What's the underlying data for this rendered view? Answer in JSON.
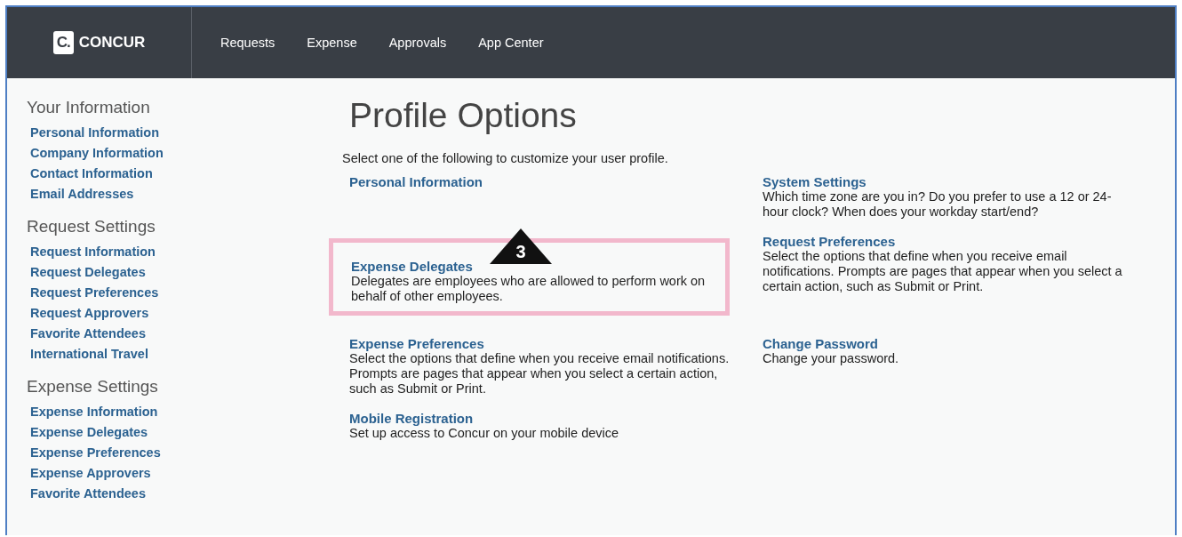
{
  "header": {
    "logo_mark": "C.",
    "logo_text": "CONCUR",
    "nav": [
      {
        "label": "Requests"
      },
      {
        "label": "Expense"
      },
      {
        "label": "Approvals"
      },
      {
        "label": "App Center"
      }
    ]
  },
  "sidebar": [
    {
      "heading": "Your Information",
      "items": [
        "Personal Information",
        "Company Information",
        "Contact Information",
        "Email Addresses"
      ]
    },
    {
      "heading": "Request Settings",
      "items": [
        "Request Information",
        "Request Delegates",
        "Request Preferences",
        "Request Approvers",
        "Favorite Attendees",
        "International Travel"
      ]
    },
    {
      "heading": "Expense Settings",
      "items": [
        "Expense Information",
        "Expense Delegates",
        "Expense Preferences",
        "Expense Approvers",
        "Favorite Attendees"
      ]
    }
  ],
  "title": "Profile Options",
  "intro": "Select one of the following to customize your user profile.",
  "option_rows": [
    {
      "cells": [
        {
          "link": "Personal Information",
          "highlighted": false
        },
        {
          "link": "System Settings",
          "description": "Which time zone are you in? Do you prefer to use a 12 or 24-hour clock? When does your workday start/end?",
          "highlighted": false
        }
      ]
    },
    {
      "cells": [
        {
          "link": "Expense Delegates",
          "description": "Delegates are employees who are allowed to perform work on behalf of other employees.",
          "highlighted": true,
          "callout": "3"
        },
        {
          "link": "Request Preferences",
          "description": "Select the options that define when you receive email notifications. Prompts are pages that appear when you select a certain action, such as Submit or Print.",
          "highlighted": false
        }
      ]
    },
    {
      "cells": [
        {
          "link": "Expense Preferences",
          "description": "Select the options that define when you receive email notifications. Prompts are pages that appear when you select a certain action, such as Submit or Print.",
          "highlighted": false
        },
        {
          "link": "Change Password",
          "description": "Change your password.",
          "highlighted": false
        }
      ]
    },
    {
      "cells": [
        {
          "link": "Mobile Registration",
          "description": "Set up access to Concur on your mobile device",
          "highlighted": false
        }
      ]
    }
  ]
}
